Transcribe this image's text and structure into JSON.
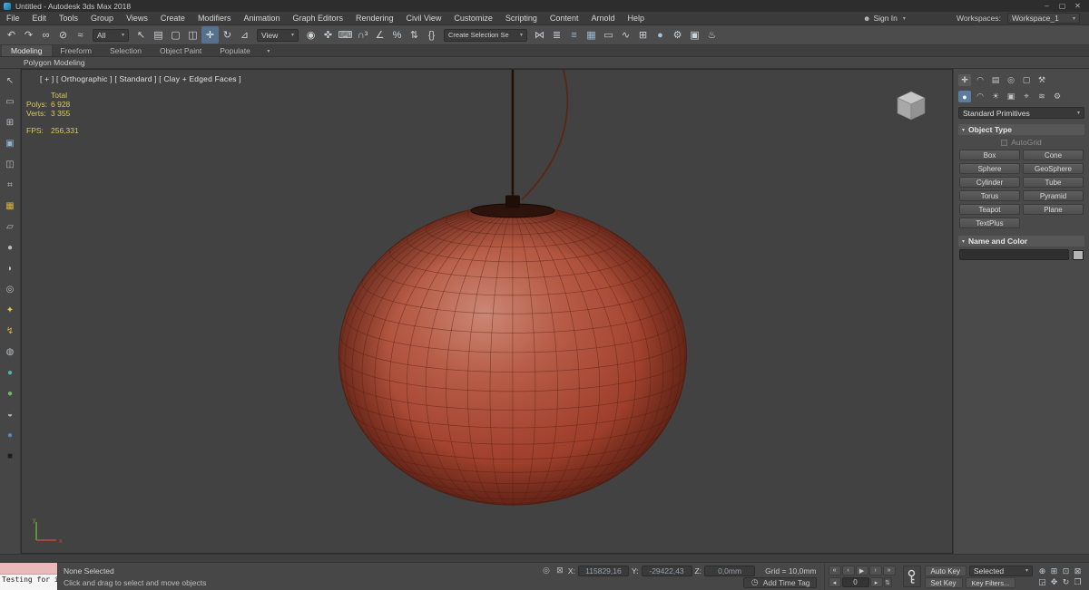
{
  "titlebar": {
    "title": "Untitled - Autodesk 3ds Max 2018",
    "minimize": "–",
    "maximize": "▢",
    "close": "✕"
  },
  "menubar": {
    "items": [
      "File",
      "Edit",
      "Tools",
      "Group",
      "Views",
      "Create",
      "Modifiers",
      "Animation",
      "Graph Editors",
      "Rendering",
      "Civil View",
      "Customize",
      "Scripting",
      "Content",
      "Arnold",
      "Help"
    ],
    "signin": "Sign In",
    "workspaces_label": "Workspaces:",
    "workspace": "Workspace_1"
  },
  "icons": {
    "chevron_down": "▾",
    "person": "☻",
    "clock": "◷",
    "isolate": "◎",
    "lock": "⊠",
    "prev_key": "◂",
    "next_key": "▸",
    "spinner": "⇅",
    "rollout_open": "▾",
    "ribbon_options": "▾"
  },
  "toolbar": {
    "group1": [
      {
        "name": "undo-icon",
        "glyph": "↶"
      },
      {
        "name": "redo-icon",
        "glyph": "↷"
      },
      {
        "name": "select-and-link-icon",
        "glyph": "∞"
      },
      {
        "name": "unlink-selection-icon",
        "glyph": "⊘"
      },
      {
        "name": "bind-to-space-warp-icon",
        "glyph": "≈"
      }
    ],
    "selection_filter": "All",
    "group2": [
      {
        "name": "select-object-icon",
        "glyph": "↖"
      },
      {
        "name": "select-by-name-icon",
        "glyph": "▤"
      },
      {
        "name": "rectangular-selection-region-icon",
        "glyph": "▢"
      },
      {
        "name": "window-crossing-icon",
        "glyph": "◫"
      },
      {
        "name": "select-and-move-icon",
        "glyph": "✛",
        "cls": "active"
      },
      {
        "name": "select-and-rotate-icon",
        "glyph": "↻"
      },
      {
        "name": "select-and-scale-icon",
        "glyph": "⊿"
      }
    ],
    "ref_coord": "View",
    "group3": [
      {
        "name": "use-pivot-point-center-icon",
        "glyph": "◉"
      },
      {
        "name": "select-and-manipulate-icon",
        "glyph": "✜"
      },
      {
        "name": "keyboard-shortcut-override-icon",
        "glyph": "⌨"
      },
      {
        "name": "snap-toggle-3d-icon",
        "glyph": "∩³"
      },
      {
        "name": "angle-snap-icon",
        "glyph": "∠"
      },
      {
        "name": "percent-snap-icon",
        "glyph": "%"
      },
      {
        "name": "spinner-snap-icon",
        "glyph": "⇅"
      },
      {
        "name": "edit-named-selection-sets-icon",
        "glyph": "{}"
      }
    ],
    "named_sets": "Create Selection Se",
    "group4": [
      {
        "name": "mirror-icon",
        "glyph": "⋈"
      },
      {
        "name": "align-icon",
        "glyph": "≣"
      },
      {
        "name": "layer-manager-icon",
        "glyph": "≡",
        "color": "#9bb8d4"
      },
      {
        "name": "scene-explorer-icon",
        "glyph": "▦",
        "color": "#9bb8d4"
      },
      {
        "name": "ribbon-toggle-icon",
        "glyph": "▭"
      },
      {
        "name": "curve-editor-icon",
        "glyph": "∿"
      },
      {
        "name": "schematic-view-icon",
        "glyph": "⊞"
      },
      {
        "name": "material-editor-icon",
        "glyph": "●",
        "color": "#9fc0de"
      },
      {
        "name": "render-setup-icon",
        "glyph": "⚙"
      },
      {
        "name": "rendered-frame-icon",
        "glyph": "▣"
      },
      {
        "name": "render-production-icon",
        "glyph": "♨"
      }
    ]
  },
  "ribbon": {
    "tabs": [
      {
        "label": "Modeling",
        "cls": "active"
      },
      {
        "label": "Freeform"
      },
      {
        "label": "Selection"
      },
      {
        "label": "Object Paint"
      },
      {
        "label": "Populate"
      }
    ],
    "subbar": "Polygon Modeling"
  },
  "left_toolbar": {
    "icons": [
      {
        "name": "select-cursor-icon",
        "glyph": "↖"
      },
      {
        "name": "marquee-icon",
        "glyph": "▭"
      },
      {
        "name": "grid-snap-icon",
        "glyph": "⊞"
      },
      {
        "name": "scene-panel-icon",
        "glyph": "▣",
        "color": "#8fb2d2"
      },
      {
        "name": "layers-panel-icon",
        "glyph": "◫"
      },
      {
        "name": "material-sample-icon",
        "glyph": "⌗"
      },
      {
        "name": "box-primitive-icon",
        "glyph": "▦",
        "color": "#d8b23a"
      },
      {
        "name": "plane-primitive-icon",
        "glyph": "▱"
      },
      {
        "name": "sphere-primitive-icon",
        "glyph": "●"
      },
      {
        "name": "cylinder-primitive-icon",
        "glyph": "◗"
      },
      {
        "name": "torus-primitive-icon",
        "glyph": "◎"
      },
      {
        "name": "star-shape-icon",
        "glyph": "✦",
        "color": "#e0c84a"
      },
      {
        "name": "lightning-icon",
        "glyph": "↯",
        "color": "#d8b23a"
      },
      {
        "name": "surface-icon",
        "glyph": "◍"
      },
      {
        "name": "teal-sphere-icon",
        "glyph": "●",
        "color": "#4fb8a8"
      },
      {
        "name": "green-sphere-icon",
        "glyph": "●",
        "color": "#6abf5e"
      },
      {
        "name": "ring-icon",
        "glyph": "◒"
      },
      {
        "name": "blue-sphere-icon",
        "glyph": "●",
        "color": "#5b86c5"
      },
      {
        "name": "dark-box-icon",
        "glyph": "■",
        "color": "#1d1d1d"
      }
    ]
  },
  "viewport": {
    "label": "[ + ] [ Orthographic ] [ Standard ] [ Clay + Edged Faces ]",
    "axis_x": "x",
    "axis_y": "y",
    "stats": [
      {
        "label": "",
        "value": "Total"
      },
      {
        "label": "Polys:",
        "value": "6 928"
      },
      {
        "label": "Verts:",
        "value": "3 355"
      },
      {
        "label": "FPS:",
        "value": "256,331",
        "cls": "gap"
      }
    ]
  },
  "command_panel": {
    "tabs": [
      {
        "name": "create-tab",
        "glyph": "✛",
        "cls": "active"
      },
      {
        "name": "modify-tab",
        "glyph": "◠"
      },
      {
        "name": "hierarchy-tab",
        "glyph": "▤"
      },
      {
        "name": "motion-tab",
        "glyph": "◎"
      },
      {
        "name": "display-tab",
        "glyph": "▢"
      },
      {
        "name": "utilities-tab",
        "glyph": "⚒"
      }
    ],
    "categories": [
      {
        "name": "geometry-category",
        "glyph": "●",
        "cls": "active"
      },
      {
        "name": "shapes-category",
        "glyph": "◠"
      },
      {
        "name": "lights-category",
        "glyph": "☀"
      },
      {
        "name": "cameras-category",
        "glyph": "▣"
      },
      {
        "name": "helpers-category",
        "glyph": "⌖"
      },
      {
        "name": "space-warps-category",
        "glyph": "≋"
      },
      {
        "name": "systems-category",
        "glyph": "⚙"
      }
    ],
    "primitives_dropdown": "Standard Primitives",
    "object_type": {
      "title": "Object Type",
      "autogrid": "AutoGrid",
      "buttons": [
        {
          "name": "box-button",
          "label": "Box"
        },
        {
          "name": "cone-button",
          "label": "Cone"
        },
        {
          "name": "sphere-button",
          "label": "Sphere"
        },
        {
          "name": "geosphere-button",
          "label": "GeoSphere"
        },
        {
          "name": "cylinder-button",
          "label": "Cylinder"
        },
        {
          "name": "tube-button",
          "label": "Tube"
        },
        {
          "name": "torus-button",
          "label": "Torus"
        },
        {
          "name": "pyramid-button",
          "label": "Pyramid"
        },
        {
          "name": "teapot-button",
          "label": "Teapot"
        },
        {
          "name": "plane-button",
          "label": "Plane"
        },
        {
          "name": "textplus-button",
          "label": "TextPlus"
        }
      ]
    },
    "name_color": {
      "title": "Name and Color"
    }
  },
  "statusbar": {
    "listener": "Testing for i",
    "status": "None Selected",
    "prompt": "Click and drag to select and move objects",
    "x_label": "X:",
    "x_value": "115829,16",
    "y_label": "Y:",
    "y_value": "-29422,43",
    "z_label": "Z:",
    "z_value": "0,0mm",
    "grid": "Grid = 10,0mm",
    "time_tag": "Add Time Tag",
    "transport": [
      {
        "name": "go-to-start-button",
        "glyph": "«"
      },
      {
        "name": "previous-frame-button",
        "glyph": "‹"
      },
      {
        "name": "play-button",
        "glyph": "▶"
      },
      {
        "name": "next-frame-button",
        "glyph": "›"
      },
      {
        "name": "go-to-end-button",
        "glyph": "»"
      }
    ],
    "frame": "0",
    "auto_key": "Auto Key",
    "set_key": "Set Key",
    "selected": "Selected",
    "key_filters": "Key Filters...",
    "nav": [
      {
        "name": "zoom-icon",
        "glyph": "⊕"
      },
      {
        "name": "zoom-all-icon",
        "glyph": "⊞"
      },
      {
        "name": "zoom-extents-icon",
        "glyph": "⊡"
      },
      {
        "name": "zoom-extents-all-icon",
        "glyph": "⊠"
      },
      {
        "name": "zoom-region-icon",
        "glyph": "◲"
      },
      {
        "name": "pan-icon",
        "glyph": "✥"
      },
      {
        "name": "orbit-icon",
        "glyph": "↻"
      },
      {
        "name": "maximize-viewport-icon",
        "glyph": "❒"
      }
    ]
  }
}
